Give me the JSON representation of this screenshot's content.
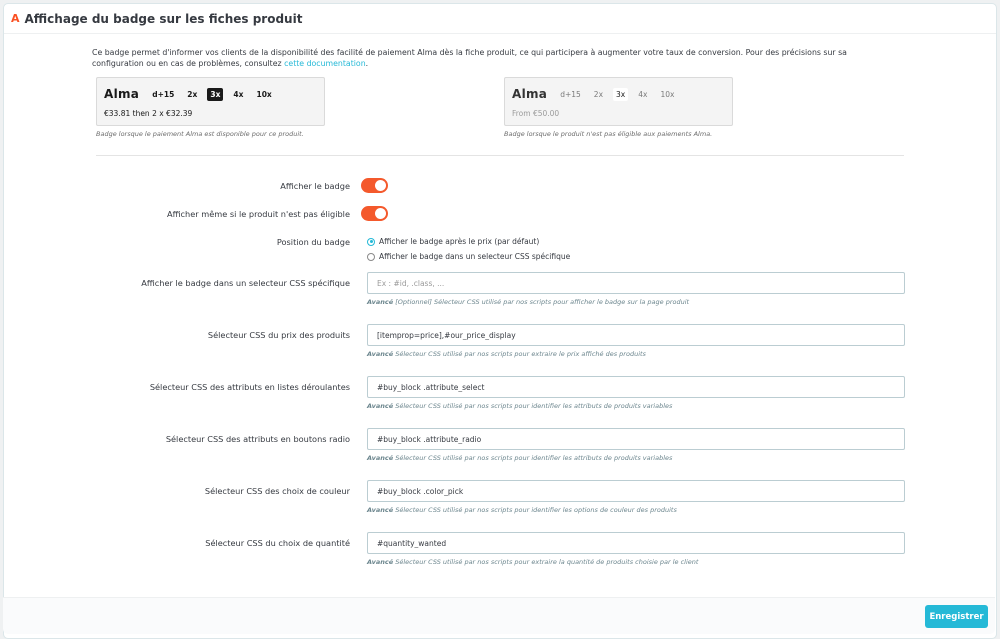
{
  "panel": {
    "icon_glyph": "A",
    "title": "Affichage du badge sur les fiches produit"
  },
  "intro": {
    "text": "Ce badge permet d'informer vos clients de la disponibilité des facilité de paiement Alma dès la fiche produit, ce qui participera à augmenter votre taux de conversion. Pour des précisions sur sa configuration ou en cas de problèmes, consultez ",
    "link_text": "cette documentation",
    "suffix": "."
  },
  "badge_eligible": {
    "logo": "Alma",
    "plans": [
      "d+15",
      "2x",
      "3x",
      "4x",
      "10x"
    ],
    "active_plan": "3x",
    "line": "€33.81 then 2 x €32.39",
    "caption": "Badge lorsque le paiement Alma est disponible pour ce produit."
  },
  "badge_not_eligible": {
    "logo": "Alma",
    "plans": [
      "d+15",
      "2x",
      "3x",
      "4x",
      "10x"
    ],
    "active_plan": "3x",
    "line": "From €50.00",
    "caption": "Badge lorsque le produit n'est pas éligible aux paiements Alma."
  },
  "toggles": {
    "show_badge_label": "Afficher le badge",
    "show_badge_on": true,
    "show_ineligible_label": "Afficher même si le produit n'est pas éligible",
    "show_ineligible_on": true
  },
  "position": {
    "label": "Position du badge",
    "options": [
      "Afficher le badge après le prix (par défaut)",
      "Afficher le badge dans un selecteur CSS spécifique"
    ],
    "selected_index": 0
  },
  "fields": [
    {
      "label": "Afficher le badge dans un selecteur CSS spécifique",
      "value": "",
      "placeholder": "Ex : #id, .class, ...",
      "help_bold": "Avancé",
      "help": " [Optionnel] Sélecteur CSS utilisé par nos scripts pour afficher le badge sur la page produit"
    },
    {
      "label": "Sélecteur CSS du prix des produits",
      "value": "[itemprop=price],#our_price_display",
      "placeholder": "",
      "help_bold": "Avancé",
      "help": " Sélecteur CSS utilisé par nos scripts pour extraire le prix affiché des produits"
    },
    {
      "label": "Sélecteur CSS des attributs en listes déroulantes",
      "value": "#buy_block .attribute_select",
      "placeholder": "",
      "help_bold": "Avancé",
      "help": " Sélecteur CSS utilisé par nos scripts pour identifier les attributs de produits variables"
    },
    {
      "label": "Sélecteur CSS des attributs en boutons radio",
      "value": "#buy_block .attribute_radio",
      "placeholder": "",
      "help_bold": "Avancé",
      "help": " Sélecteur CSS utilisé par nos scripts pour identifier les attributs de produits variables"
    },
    {
      "label": "Sélecteur CSS des choix de couleur",
      "value": "#buy_block .color_pick",
      "placeholder": "",
      "help_bold": "Avancé",
      "help": " Sélecteur CSS utilisé par nos scripts pour identifier les options de couleur des produits"
    },
    {
      "label": "Sélecteur CSS du choix de quantité",
      "value": "#quantity_wanted",
      "placeholder": "",
      "help_bold": "Avancé",
      "help": " Sélecteur CSS utilisé par nos scripts pour extraire la quantité de produits choisie par le client"
    }
  ],
  "footer": {
    "save_label": "Enregistrer"
  },
  "colors": {
    "accent": "#25b9d7",
    "toggle_on": "#f4592c",
    "alma_orange": "#fa5022"
  }
}
